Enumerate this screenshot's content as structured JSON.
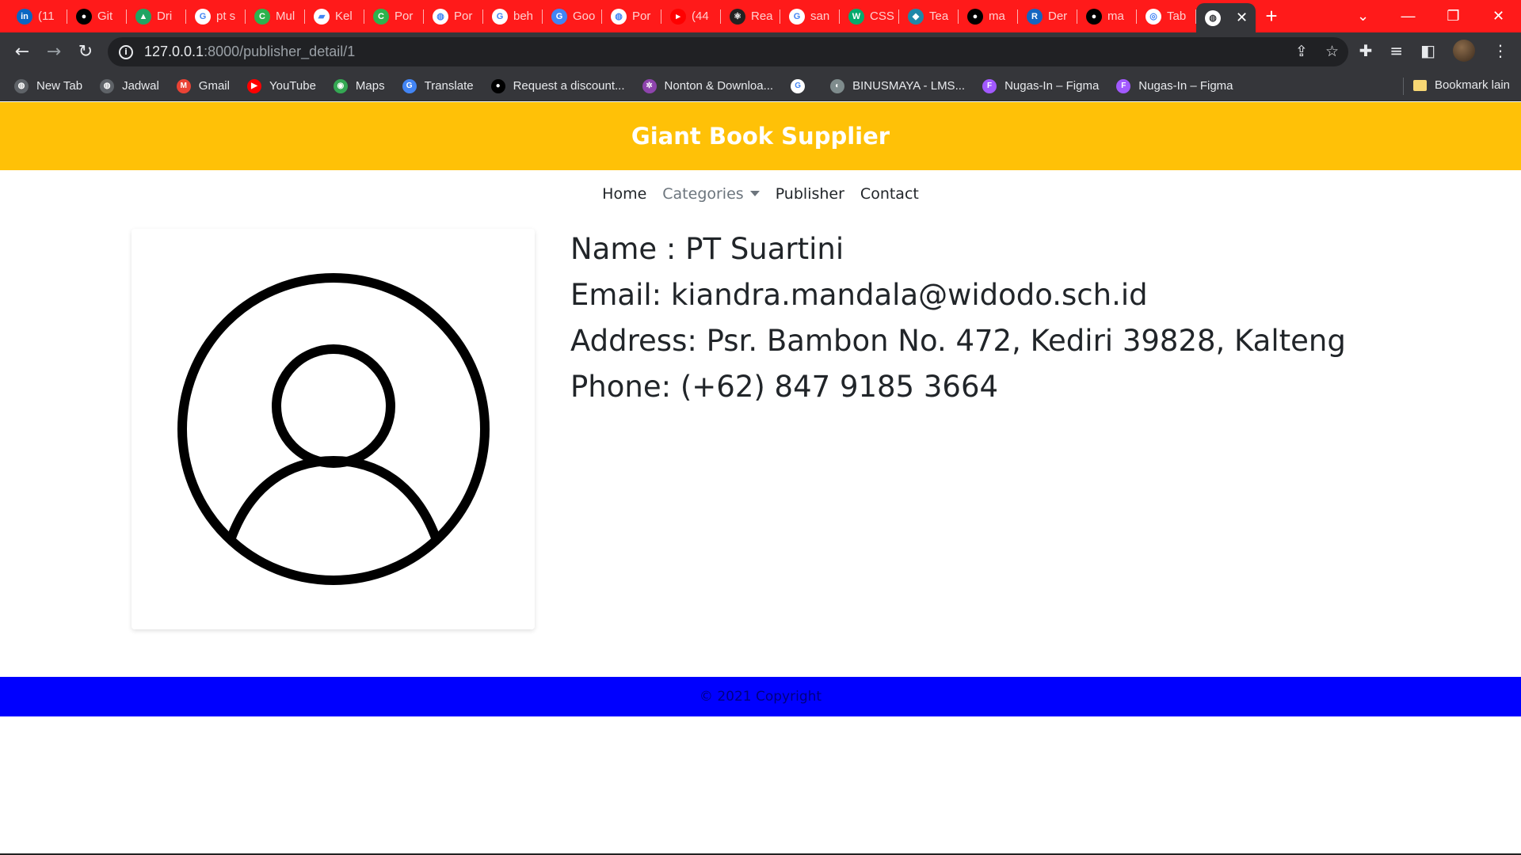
{
  "browser": {
    "tabs": [
      {
        "title": "(11",
        "icon": "linkedin-icon",
        "color": "#0a66c2",
        "glyph": "in"
      },
      {
        "title": "Git",
        "icon": "github-icon",
        "color": "#000000",
        "glyph": "●"
      },
      {
        "title": "Dri",
        "icon": "drive-icon",
        "color": "#1fa463",
        "glyph": "▲"
      },
      {
        "title": "pt s",
        "icon": "google-icon",
        "color": "#ffffff",
        "glyph": "G"
      },
      {
        "title": "Mul",
        "icon": "c-icon",
        "color": "#2db24d",
        "glyph": "C"
      },
      {
        "title": "Kel",
        "icon": "classroom-icon",
        "color": "#ffffff",
        "glyph": "▰"
      },
      {
        "title": "Por",
        "icon": "c-icon",
        "color": "#2db24d",
        "glyph": "C"
      },
      {
        "title": "Por",
        "icon": "globe-icon",
        "color": "#ffffff",
        "glyph": "◍"
      },
      {
        "title": "beh",
        "icon": "google-icon",
        "color": "#ffffff",
        "glyph": "G"
      },
      {
        "title": "Goo",
        "icon": "translate-icon",
        "color": "#4285f4",
        "glyph": "G"
      },
      {
        "title": "Por",
        "icon": "globe-icon",
        "color": "#ffffff",
        "glyph": "◍"
      },
      {
        "title": "(44",
        "icon": "youtube-icon",
        "color": "#ff0000",
        "glyph": "▸"
      },
      {
        "title": "Rea",
        "icon": "react-icon",
        "color": "#222222",
        "glyph": "⚛"
      },
      {
        "title": "san",
        "icon": "google-icon",
        "color": "#ffffff",
        "glyph": "G"
      },
      {
        "title": "CSS",
        "icon": "w3-icon",
        "color": "#04aa6d",
        "glyph": "W"
      },
      {
        "title": "Tea",
        "icon": "diamond-icon",
        "color": "#1e88a8",
        "glyph": "◆"
      },
      {
        "title": "ma",
        "icon": "github-icon",
        "color": "#000000",
        "glyph": "●"
      },
      {
        "title": "Der",
        "icon": "r-icon",
        "color": "#1565c0",
        "glyph": "R"
      },
      {
        "title": "ma",
        "icon": "github-icon",
        "color": "#000000",
        "glyph": "●"
      },
      {
        "title": "Tab",
        "icon": "chrome-icon",
        "color": "#ffffff",
        "glyph": "◎"
      }
    ],
    "active_tab": {
      "icon": "globe-icon"
    },
    "url_host": "127.0.0.1",
    "url_path": ":8000/publisher_detail/1",
    "bookmarks": [
      {
        "label": "New Tab",
        "icon": "globe-icon",
        "color": "#5f6368",
        "glyph": "◍"
      },
      {
        "label": "Jadwal",
        "icon": "globe-icon",
        "color": "#5f6368",
        "glyph": "◍"
      },
      {
        "label": "Gmail",
        "icon": "gmail-icon",
        "color": "#ea4335",
        "glyph": "M"
      },
      {
        "label": "YouTube",
        "icon": "youtube-icon",
        "color": "#ff0000",
        "glyph": "▶"
      },
      {
        "label": "Maps",
        "icon": "maps-icon",
        "color": "#34a853",
        "glyph": "◉"
      },
      {
        "label": "Translate",
        "icon": "translate-icon",
        "color": "#4285f4",
        "glyph": "G"
      },
      {
        "label": "Request a discount...",
        "icon": "github-icon",
        "color": "#000000",
        "glyph": "●"
      },
      {
        "label": "Nonton & Downloa...",
        "icon": "pinwheel-icon",
        "color": "#8e44ad",
        "glyph": "✲"
      },
      {
        "label": "",
        "icon": "google-icon",
        "color": "#ffffff",
        "glyph": "G"
      },
      {
        "label": "BINUSMAYA - LMS...",
        "icon": "binus-icon",
        "color": "#7f8c8d",
        "glyph": "◐"
      },
      {
        "label": "Nugas-In – Figma",
        "icon": "figma-icon",
        "color": "#a259ff",
        "glyph": "F"
      },
      {
        "label": "Nugas-In – Figma",
        "icon": "figma-icon",
        "color": "#a259ff",
        "glyph": "F"
      }
    ],
    "other_bookmarks": "Bookmark lain"
  },
  "site": {
    "title": "Giant Book Supplier",
    "nav": {
      "home": "Home",
      "categories": "Categories",
      "publisher": "Publisher",
      "contact": "Contact"
    },
    "publisher": {
      "name": "Name : PT Suartini",
      "email": "Email: kiandra.mandala@widodo.sch.id",
      "address": "Address: Psr. Bambon No. 472, Kediri 39828, Kalteng",
      "phone": "Phone: (+62) 847 9185 3664"
    },
    "footer": "© 2021 Copyright"
  },
  "colors": {
    "tabstrip": "#ff1a1a",
    "header": "#ffc107",
    "footer": "#0000ff"
  }
}
